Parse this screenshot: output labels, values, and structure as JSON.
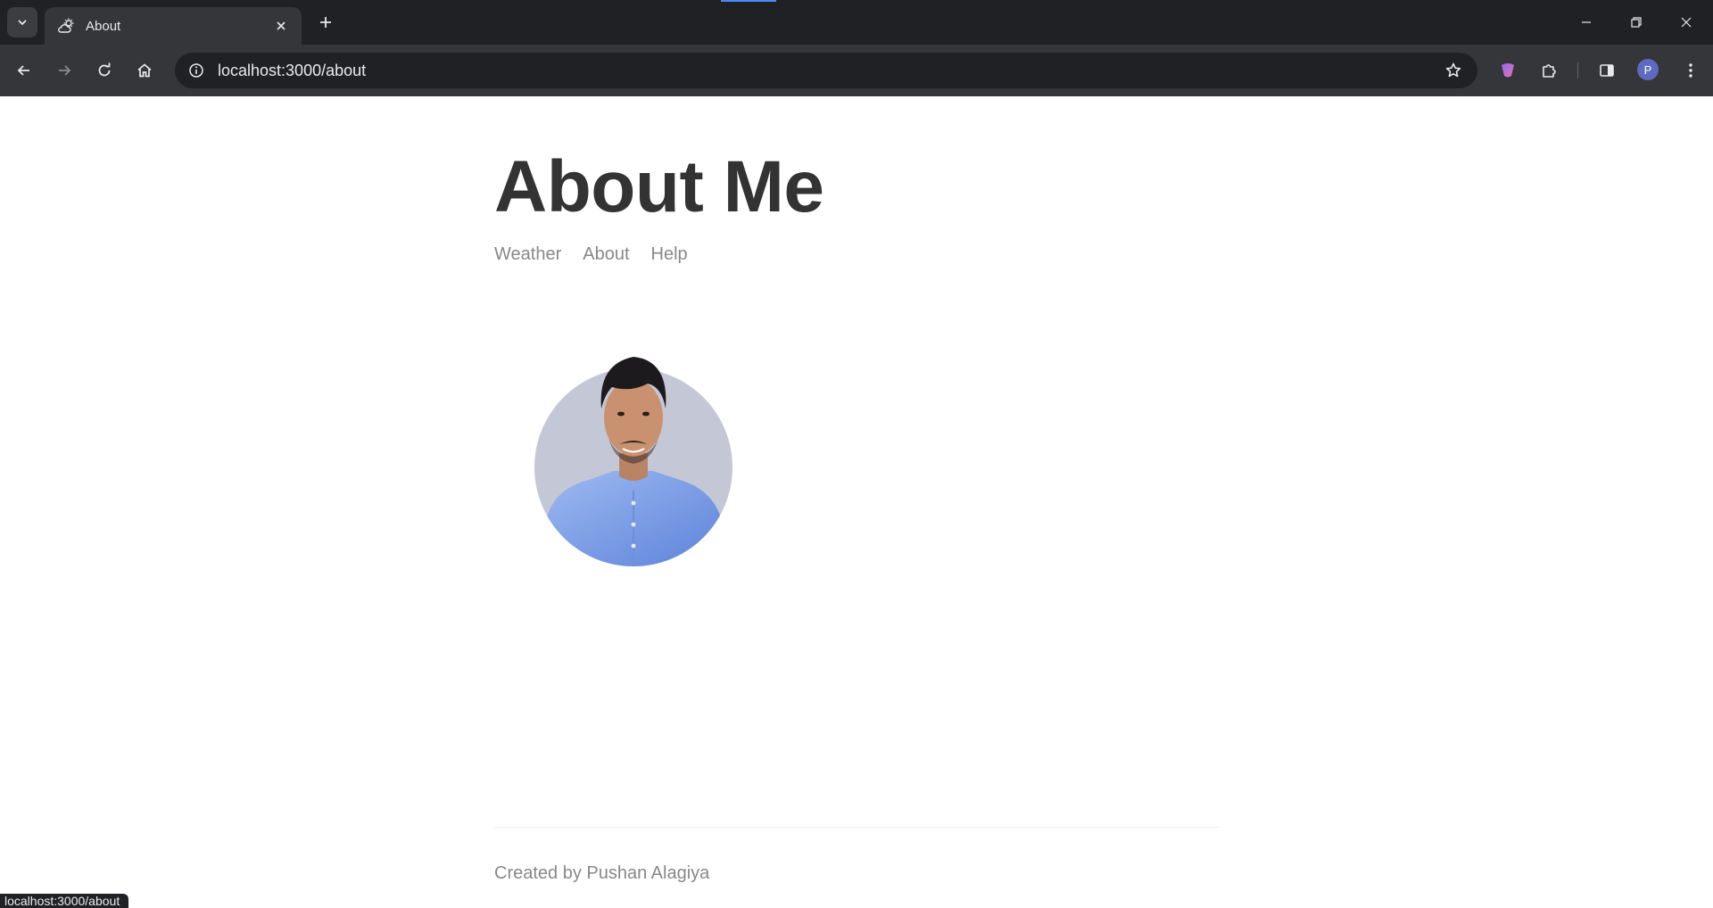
{
  "browser": {
    "tab_title": "About",
    "url": "localhost:3000/about",
    "profile_initial": "P",
    "status_url": "localhost:3000/about"
  },
  "page": {
    "title": "About Me",
    "nav": [
      "Weather",
      "About",
      "Help"
    ],
    "footer": "Created by Pushan Alagiya"
  },
  "colors": {
    "title": "#333333",
    "nav_link": "#888888",
    "chrome_dark": "#202124",
    "chrome_toolbar": "#35363a",
    "avatar": "#5c6bc0",
    "portrait_bg": "#c4c7d6",
    "shirt": "#7fa3e8"
  }
}
